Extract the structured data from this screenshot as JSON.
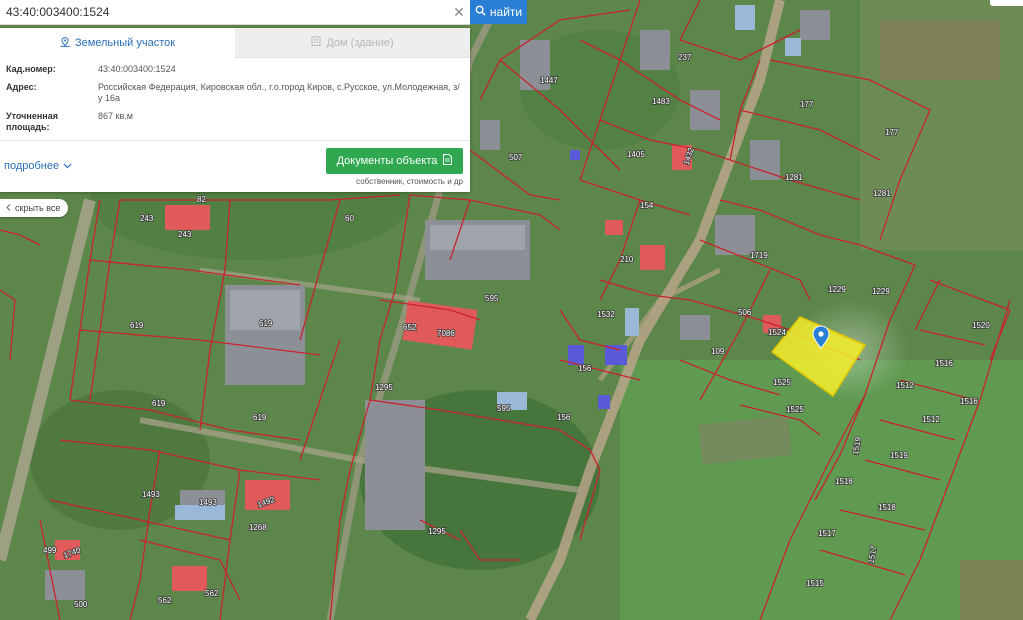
{
  "search": {
    "value": "43:40:003400:1524",
    "button_label": "найти"
  },
  "panel": {
    "tabs": [
      {
        "label": "Земельный участок",
        "icon": "land-plot-icon",
        "active": true
      },
      {
        "label": "Дом (здание)",
        "icon": "building-icon",
        "active": false
      }
    ],
    "fields": [
      {
        "key": "Кад.номер:",
        "value": "43:40:003400:1524"
      },
      {
        "key": "Адрес:",
        "value": "Российская Федерация, Кировская обл., г.о.город Киров, с.Русское, ул.Молодежная, з/у 16а"
      },
      {
        "key": "Уточненная площадь:",
        "value": "867 кв.м"
      }
    ],
    "more_link": "подробнее",
    "docs_button": "Документы объекта",
    "docs_sub": "собственник, стоимость и др"
  },
  "hide_all": "скрыть все",
  "colors": {
    "accent": "#2a7fd4",
    "docs_green": "#2fa84f",
    "boundary": "#c8232c",
    "selected_fill": "#f5ef2a",
    "marker": "#2a7fd4"
  },
  "map": {
    "labels": [
      "1447",
      "237",
      "177",
      "177",
      "1483",
      "1405",
      "1432",
      "507",
      "1281",
      "1281",
      "154",
      "210",
      "1719",
      "1229",
      "1229",
      "1520",
      "506",
      "1532",
      "1524",
      "109",
      "1525",
      "1525",
      "1516",
      "1512",
      "1516",
      "1512",
      "1519",
      "1518",
      "1518",
      "1517",
      "1517",
      "1515",
      "1519",
      "243",
      "243",
      "60",
      "82",
      "619",
      "619",
      "619",
      "619",
      "652",
      "7086",
      "595",
      "595",
      "1295",
      "1295",
      "156",
      "156",
      "1493",
      "1493",
      "1268",
      "1492",
      "499",
      "1740",
      "562",
      "562",
      "500"
    ]
  }
}
